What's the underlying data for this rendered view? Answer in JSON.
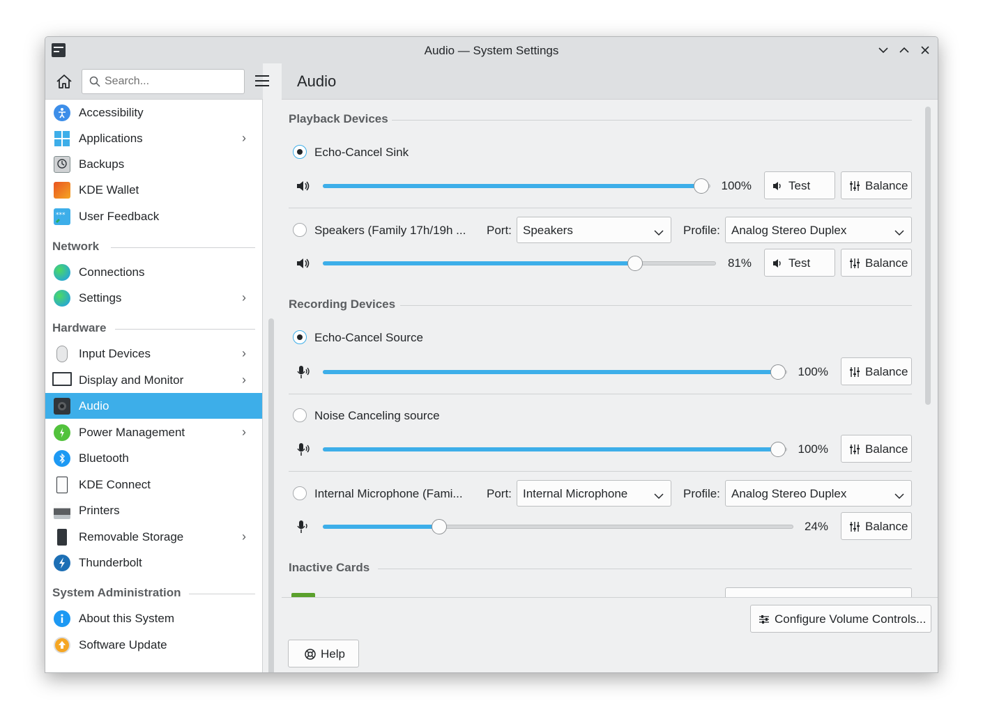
{
  "window": {
    "title": "Audio — System Settings"
  },
  "sidebar": {
    "search_placeholder": "Search...",
    "items": [
      {
        "label": "Accessibility"
      },
      {
        "label": "Applications"
      },
      {
        "label": "Backups"
      },
      {
        "label": "KDE Wallet"
      },
      {
        "label": "User Feedback"
      },
      {
        "label": "Connections"
      },
      {
        "label": "Settings"
      },
      {
        "label": "Input Devices"
      },
      {
        "label": "Display and Monitor"
      },
      {
        "label": "Audio"
      },
      {
        "label": "Power Management"
      },
      {
        "label": "Bluetooth"
      },
      {
        "label": "KDE Connect"
      },
      {
        "label": "Printers"
      },
      {
        "label": "Removable Storage"
      },
      {
        "label": "Thunderbolt"
      },
      {
        "label": "About this System"
      },
      {
        "label": "Software Update"
      }
    ],
    "categories": [
      "Network",
      "Hardware",
      "System Administration"
    ],
    "active": "Audio"
  },
  "page": {
    "title": "Audio"
  },
  "sections": {
    "playback": "Playback Devices",
    "recording": "Recording Devices",
    "inactive": "Inactive Cards"
  },
  "labels": {
    "port": "Port:",
    "profile": "Profile:",
    "test": "Test",
    "balance": "Balance"
  },
  "playback": [
    {
      "name": "Echo-Cancel Sink",
      "selected": true,
      "volume": 100,
      "volume_text": "100%"
    },
    {
      "name": "Speakers (Family 17h/19h ...",
      "selected": false,
      "volume": 81,
      "volume_text": "81%",
      "port": "Speakers",
      "profile": "Analog Stereo Duplex"
    }
  ],
  "recording": [
    {
      "name": "Echo-Cancel Source",
      "selected": true,
      "volume": 100,
      "volume_text": "100%"
    },
    {
      "name": "Noise Canceling source",
      "selected": false,
      "volume": 100,
      "volume_text": "100%"
    },
    {
      "name": "Internal Microphone (Fami...",
      "selected": false,
      "volume": 24,
      "volume_text": "24%",
      "port": "Internal Microphone",
      "profile": "Analog Stereo Duplex"
    }
  ],
  "footer": {
    "configure": "Configure Volume Controls...",
    "help": "Help"
  },
  "colors": {
    "accent": "#3daee9",
    "window_bg": "#eff0f1",
    "header_bg": "#dee0e2"
  }
}
